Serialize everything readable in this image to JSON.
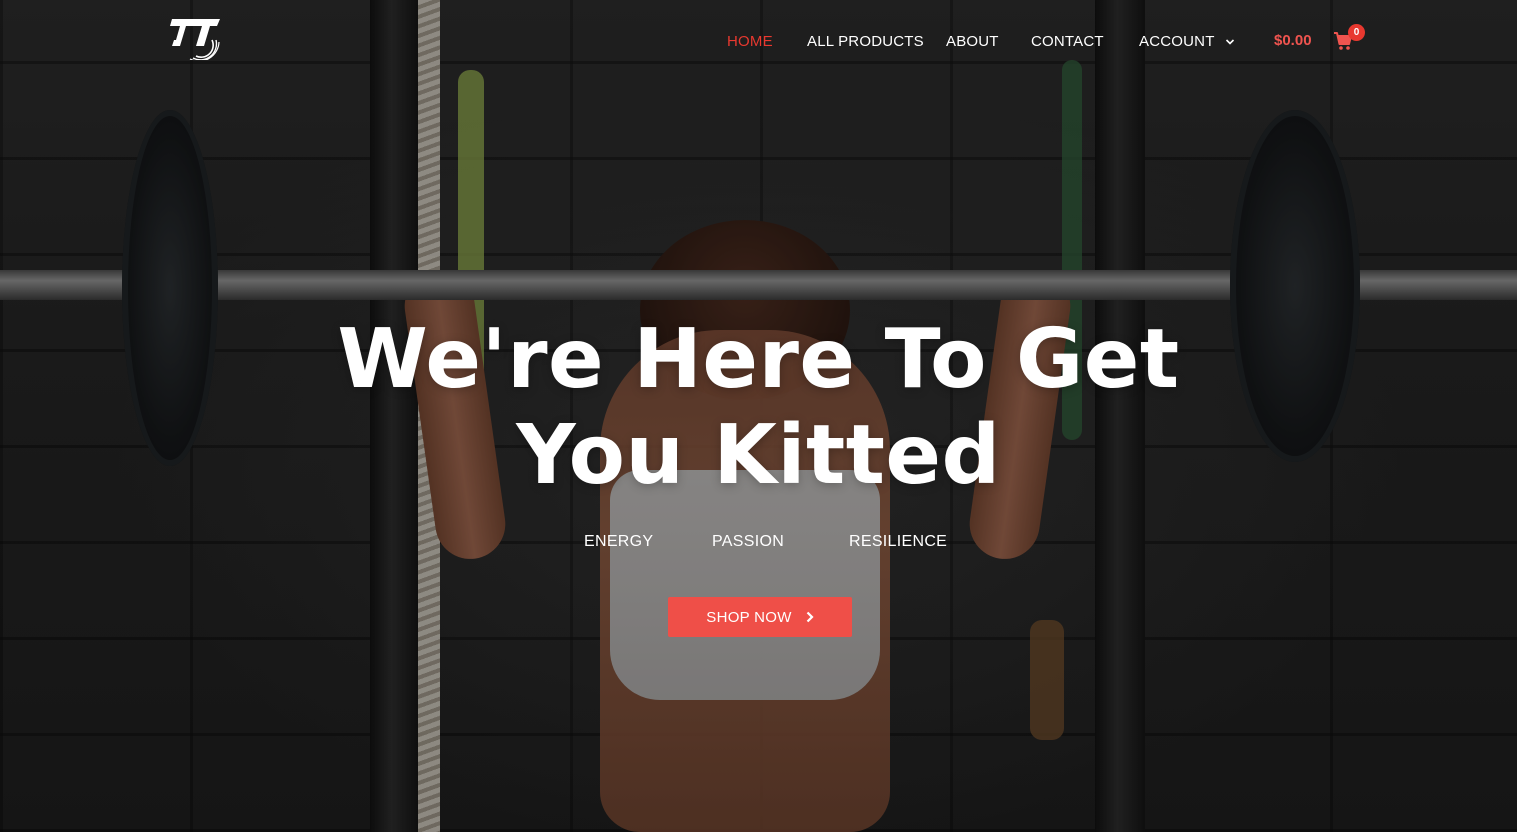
{
  "brand": {
    "logo_text": "JT"
  },
  "nav": {
    "items": [
      {
        "label": "HOME",
        "active": true
      },
      {
        "label": "ALL PRODUCTS",
        "active": false
      },
      {
        "label": "ABOUT",
        "active": false
      },
      {
        "label": "CONTACT",
        "active": false
      },
      {
        "label": "ACCOUNT",
        "active": false,
        "has_dropdown": true
      }
    ]
  },
  "cart": {
    "total": "$0.00",
    "count": "0",
    "icon": "shopping-cart-icon"
  },
  "hero": {
    "headline_line1": "We're Here To Get",
    "headline_line2": "You Kitted",
    "values": [
      "ENERGY",
      "PASSION",
      "RESILIENCE"
    ],
    "cta_label": "SHOP NOW",
    "cta_icon": "chevron-right-icon"
  },
  "colors": {
    "accent": "#ef4f48",
    "active_nav": "#e8382f",
    "text": "#ffffff"
  }
}
